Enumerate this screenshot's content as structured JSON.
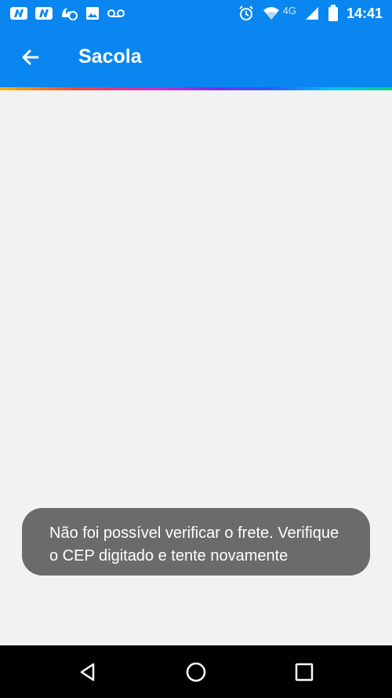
{
  "status_bar": {
    "time": "14:41",
    "network_type": "4G",
    "left_icons": [
      "nav-n-icon",
      "nav-n-icon",
      "activity-icon",
      "image-icon",
      "voicemail-icon"
    ],
    "right_icons": [
      "alarm-icon",
      "wifi-icon",
      "signal-icon",
      "battery-icon"
    ]
  },
  "app_bar": {
    "title": "Sacola",
    "back_icon": "arrow-left-icon",
    "color": "#0a86f0"
  },
  "toast": {
    "message": "Não foi possível verificar o frete. Verifique o CEP digitado e tente novamente"
  },
  "nav_bar": {
    "buttons": [
      "back-triangle-icon",
      "home-circle-icon",
      "recents-square-icon"
    ]
  }
}
